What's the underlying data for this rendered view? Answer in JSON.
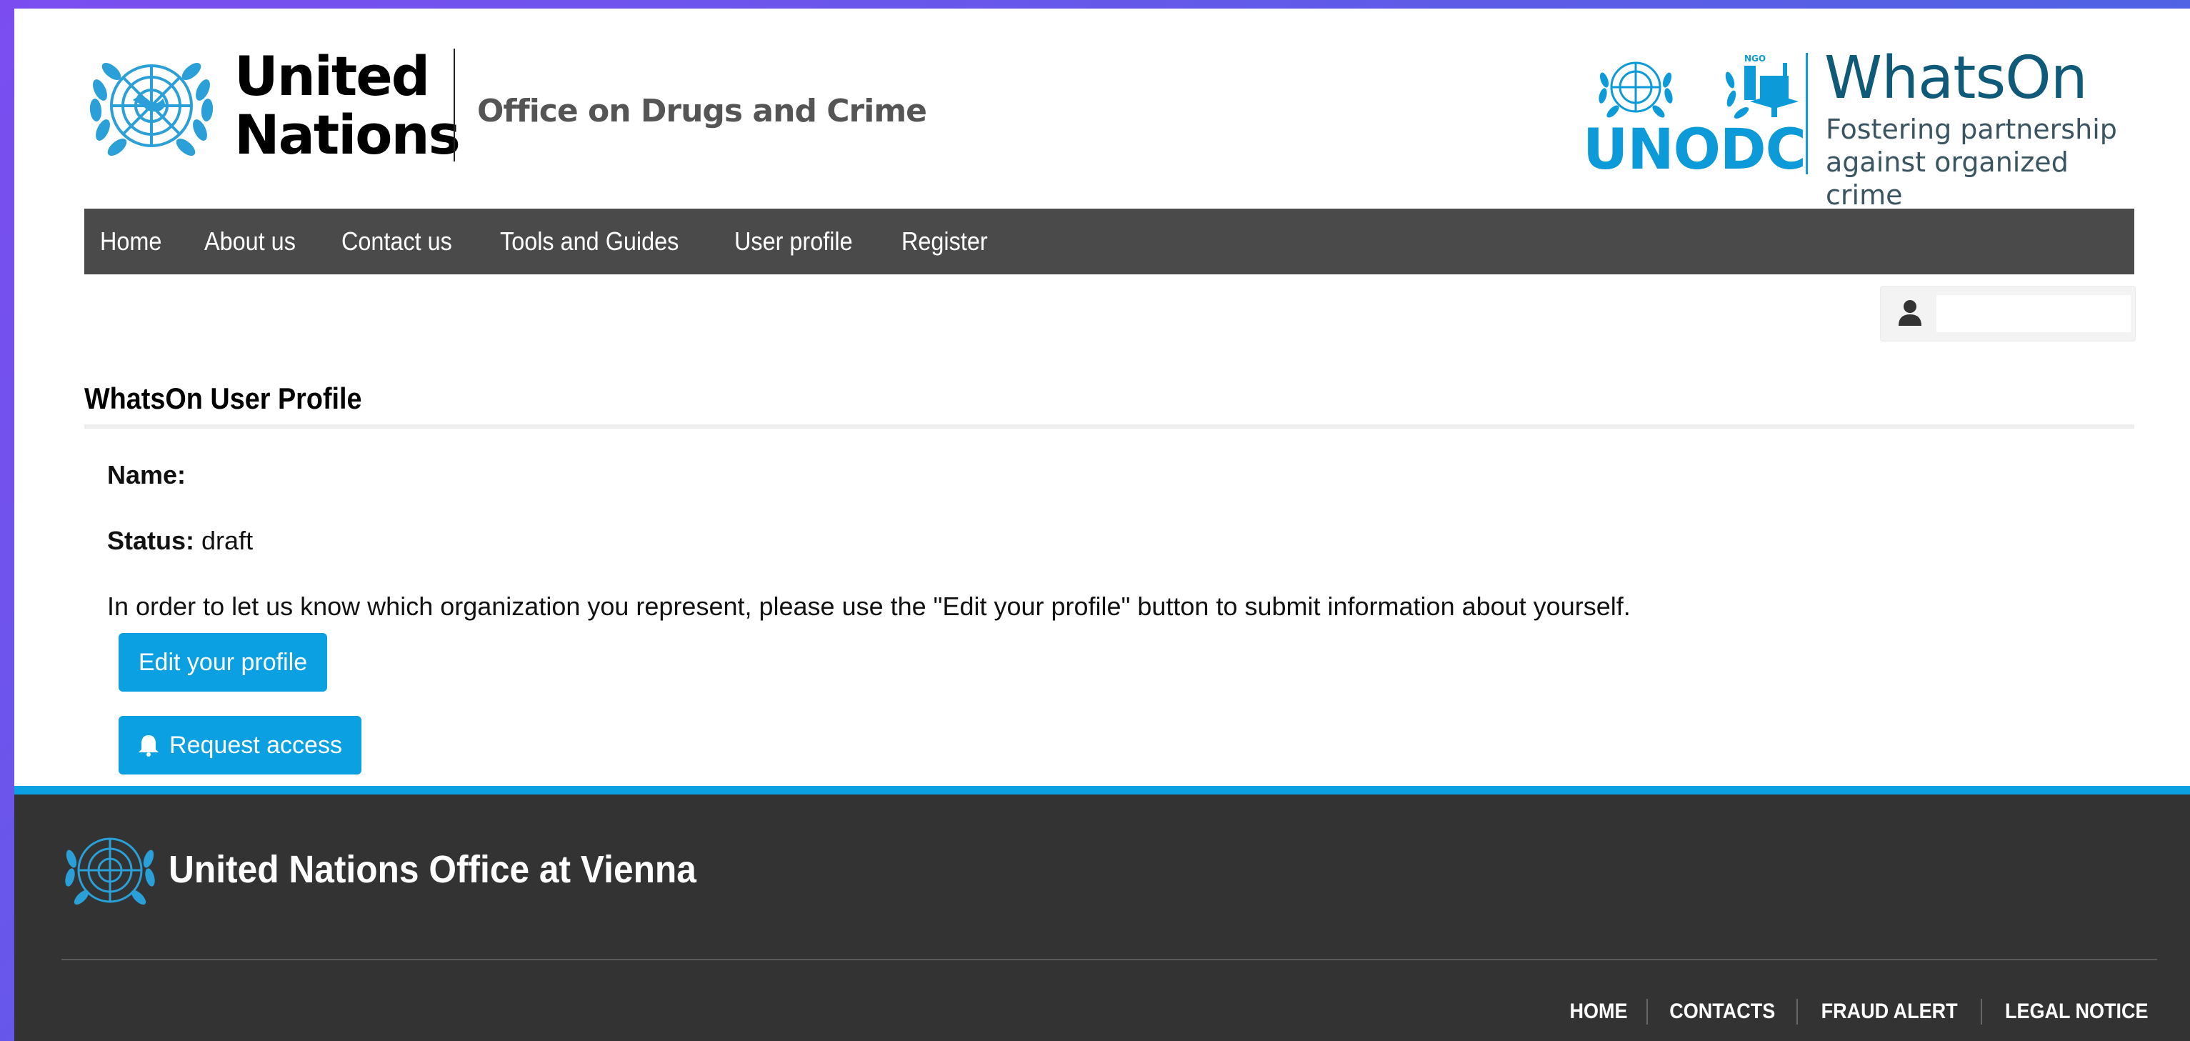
{
  "header": {
    "un_logo_line1": "United",
    "un_logo_line2": "Nations",
    "office_name": "Office on Drugs and Crime",
    "unodc_label": "UNODC",
    "whatson_title": "WhatsOn",
    "whatson_tagline_line1": "Fostering partnership",
    "whatson_tagline_line2": "against organized crime",
    "ngo_badge": "NGO"
  },
  "nav": {
    "items": [
      "Home",
      "About us",
      "Contact us",
      "Tools and Guides",
      "User profile",
      "Register"
    ]
  },
  "user_menu": {
    "icon": "user-icon"
  },
  "profile": {
    "title": "WhatsOn User Profile",
    "name_label": "Name:",
    "name_value": "",
    "status_label": "Status:",
    "status_value": "draft",
    "info_text": "In order to let us know which organization you represent, please use the \"Edit your profile\" button to submit information about yourself.",
    "edit_button": "Edit your profile",
    "request_button": "Request access",
    "request_icon": "bell-icon"
  },
  "footer": {
    "title": "United Nations Office at Vienna",
    "links": [
      "HOME",
      "CONTACTS",
      "FRAUD ALERT",
      "LEGAL NOTICE"
    ]
  },
  "colors": {
    "accent": "#0aa0e2",
    "nav_bg": "#4a4a4a",
    "footer_bg": "#333333",
    "whatson_dark": "#0f5a78",
    "unodc_blue": "#0c9ad8"
  }
}
